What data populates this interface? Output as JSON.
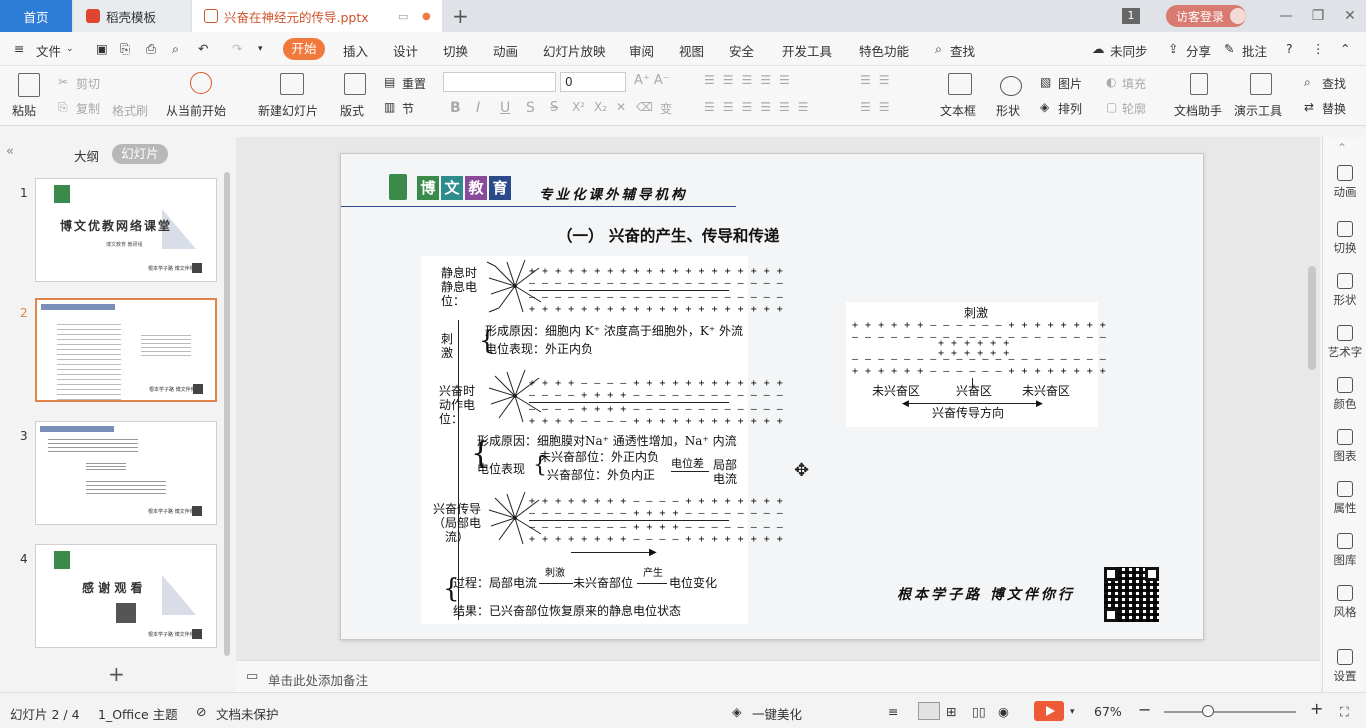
{
  "tabs": {
    "home": "首页",
    "template": "稻壳模板",
    "document": "兴奋在神经元的传导.pptx",
    "badge": "1",
    "login": "访客登录"
  },
  "menu": {
    "file": "文件",
    "items": [
      "开始",
      "插入",
      "设计",
      "切换",
      "动画",
      "幻灯片放映",
      "审阅",
      "视图",
      "安全",
      "开发工具",
      "特色功能",
      "查找"
    ],
    "sync": "未同步",
    "share": "分享",
    "comment": "批注"
  },
  "ribbon": {
    "paste": "粘贴",
    "cut": "剪切",
    "copy": "复制",
    "format_painter": "格式刷",
    "from_current": "从当前开始",
    "new_slide": "新建幻灯片",
    "layout": "版式",
    "reset": "重置",
    "section": "节",
    "font_size": "0",
    "textbox": "文本框",
    "shape": "形状",
    "picture": "图片",
    "fill": "填充",
    "arrange": "排列",
    "outline": "轮廓",
    "doc_assistant": "文档助手",
    "present_tools": "演示工具",
    "find": "查找",
    "replace": "替换"
  },
  "left_panel": {
    "outline_tab": "大纲",
    "slides_tab": "幻灯片",
    "slides": [
      {
        "num": "1",
        "title": "博文优教网络课堂",
        "sub": "博文教育 教研组",
        "footer": "根本学子路 博文伴你行"
      },
      {
        "num": "2",
        "title": "",
        "footer": "根本学子路 博文伴你行"
      },
      {
        "num": "3",
        "title": "",
        "footer": "根本学子路 博文伴你行"
      },
      {
        "num": "4",
        "title": "感 谢 观 看",
        "footer": "根本学子路 博文伴你行"
      }
    ]
  },
  "slide": {
    "logo_chars": [
      "博",
      "文",
      "教",
      "育"
    ],
    "subtitle": "专业化课外辅导机构",
    "title": "（一）  兴奋的产生、传导和传递",
    "diagram": {
      "rest_label": "静息时静息电位：",
      "stimulus": "刺激",
      "cause1": "形成原因：细胞内 K⁺ 浓度高于细胞外，K⁺ 外流",
      "potential1": "电位表现：外正内负",
      "excite_label": "兴奋时动作电位：",
      "cause2": "形成原因：细胞膜对Na⁺ 通透性增加，Na⁺ 内流",
      "potential2": "电位表现",
      "unexcited": "未兴奋部位：外正内负",
      "excited": "兴奋部位：外负内正",
      "potential_diff": "电位差",
      "local_current": "局部电流",
      "conduct_label": "兴奋传导（局部电流）",
      "process": "过程：局部电流",
      "process_stim": "刺激",
      "process_mid": "未兴奋部位",
      "process_gen": "产生",
      "process_end": "电位变化",
      "result": "结果：已兴奋部位恢复原来的静息电位状态"
    },
    "diagram2": {
      "stimulus": "刺激",
      "left": "未兴奋区",
      "mid": "兴奋区",
      "right": "未兴奋区",
      "direction": "兴奋传导方向"
    },
    "slogan": "根本学子路 博文伴你行"
  },
  "right_sidebar": [
    "动画",
    "切换",
    "形状",
    "艺术字",
    "颜色",
    "图表",
    "属性",
    "图库",
    "风格",
    "设置"
  ],
  "notes_placeholder": "单击此处添加备注",
  "status": {
    "slide_pos": "幻灯片 2 / 4",
    "theme": "1_Office 主题",
    "protect": "文档未保护",
    "beautify": "一键美化",
    "zoom": "67%"
  },
  "colors": {
    "accent": "#f07a3e",
    "home_tab": "#2d7cd6",
    "selected_thumb": "#e0844a",
    "logo": [
      "#3a8a4a",
      "#2e8c8c",
      "#8a4a9a",
      "#2a4a8a"
    ]
  }
}
